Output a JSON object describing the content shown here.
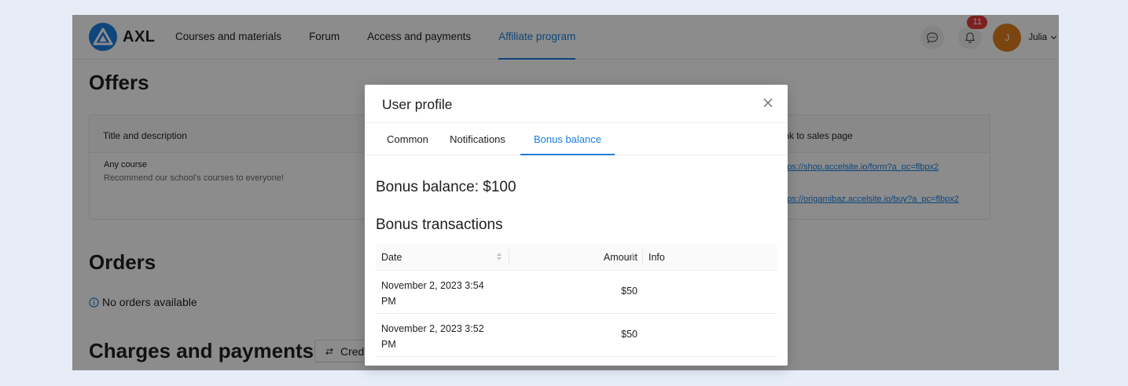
{
  "header": {
    "logo_text": "AXL",
    "nav": [
      {
        "label": "Courses and materials",
        "active": false
      },
      {
        "label": "Forum",
        "active": false
      },
      {
        "label": "Access and payments",
        "active": false
      },
      {
        "label": "Affiliate program",
        "active": true
      }
    ],
    "notification_count": "11",
    "avatar_initial": "J",
    "user_name": "Julia"
  },
  "page": {
    "offers_title": "Offers",
    "offers_table": {
      "col_title": "Title and description",
      "col_link": "Link to sales page",
      "offer_name": "Any course",
      "offer_desc": "Recommend our school's courses to everyone!",
      "link1": "https://shop.accelsite.io/form?a_pc=flbpx2",
      "link2": "https://origamibaz.accelsite.io/buy?a_pc=flbpx2"
    },
    "orders_title": "Orders",
    "no_orders": "No orders available",
    "charges_title": "Charges and payments",
    "credit_button": "Credit"
  },
  "modal": {
    "title": "User profile",
    "tabs": [
      {
        "label": "Common",
        "active": false
      },
      {
        "label": "Notifications",
        "active": false
      },
      {
        "label": "Bonus balance",
        "active": true
      }
    ],
    "bonus_balance": "Bonus balance: $100",
    "transactions_title": "Bonus transactions",
    "columns": {
      "date": "Date",
      "amount": "Amount",
      "info": "Info"
    },
    "rows": [
      {
        "date": "November 2, 2023 3:54 PM",
        "amount": "$50",
        "info": ""
      },
      {
        "date": "November 2, 2023 3:52 PM",
        "amount": "$50",
        "info": ""
      }
    ]
  },
  "colors": {
    "accent": "#1a7fe0",
    "badge": "#e23b3b",
    "avatar": "#e07e1e"
  }
}
